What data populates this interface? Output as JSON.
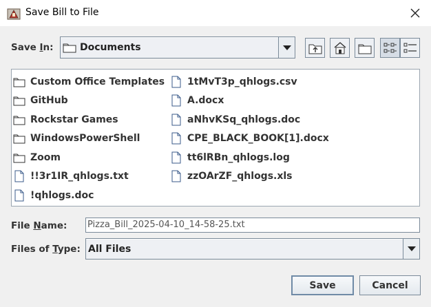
{
  "window": {
    "title": "Save Bill to File",
    "close_glyph": "✕"
  },
  "save_in": {
    "label_pre": "Save ",
    "label_mnemonic": "I",
    "label_post": "n:",
    "value": "Documents"
  },
  "toolbar": {
    "buttons": [
      {
        "name": "up-one-level-icon"
      },
      {
        "name": "home-icon"
      },
      {
        "name": "new-folder-icon"
      },
      {
        "name": "list-view-icon",
        "pressed": true
      },
      {
        "name": "details-view-icon"
      }
    ]
  },
  "files": {
    "column1": [
      {
        "name": "Custom Office Templates",
        "type": "folder"
      },
      {
        "name": "GitHub",
        "type": "folder"
      },
      {
        "name": "Rockstar Games",
        "type": "folder"
      },
      {
        "name": "WindowsPowerShell",
        "type": "folder"
      },
      {
        "name": "Zoom",
        "type": "folder"
      },
      {
        "name": "!!3r1IR_qhlogs.txt",
        "type": "file"
      },
      {
        "name": "!qhlogs.doc",
        "type": "file"
      }
    ],
    "column2": [
      {
        "name": "1tMvT3p_qhlogs.csv",
        "type": "file"
      },
      {
        "name": "A.docx",
        "type": "file"
      },
      {
        "name": "aNhvKSq_qhlogs.doc",
        "type": "file"
      },
      {
        "name": "CPE_BLACK_BOOK[1].docx",
        "type": "file"
      },
      {
        "name": "tt6lRBn_qhlogs.log",
        "type": "file"
      },
      {
        "name": "zzOArZF_qhlogs.xls",
        "type": "file"
      }
    ]
  },
  "file_name": {
    "label_pre": "File ",
    "label_mnemonic": "N",
    "label_post": "ame:",
    "value": "Pizza_Bill_2025-04-10_14-58-25.txt"
  },
  "file_type": {
    "label_pre": "Files of ",
    "label_mnemonic": "T",
    "label_post": "ype:",
    "value": "All Files"
  },
  "actions": {
    "save_label": "Save",
    "cancel_label": "Cancel"
  }
}
